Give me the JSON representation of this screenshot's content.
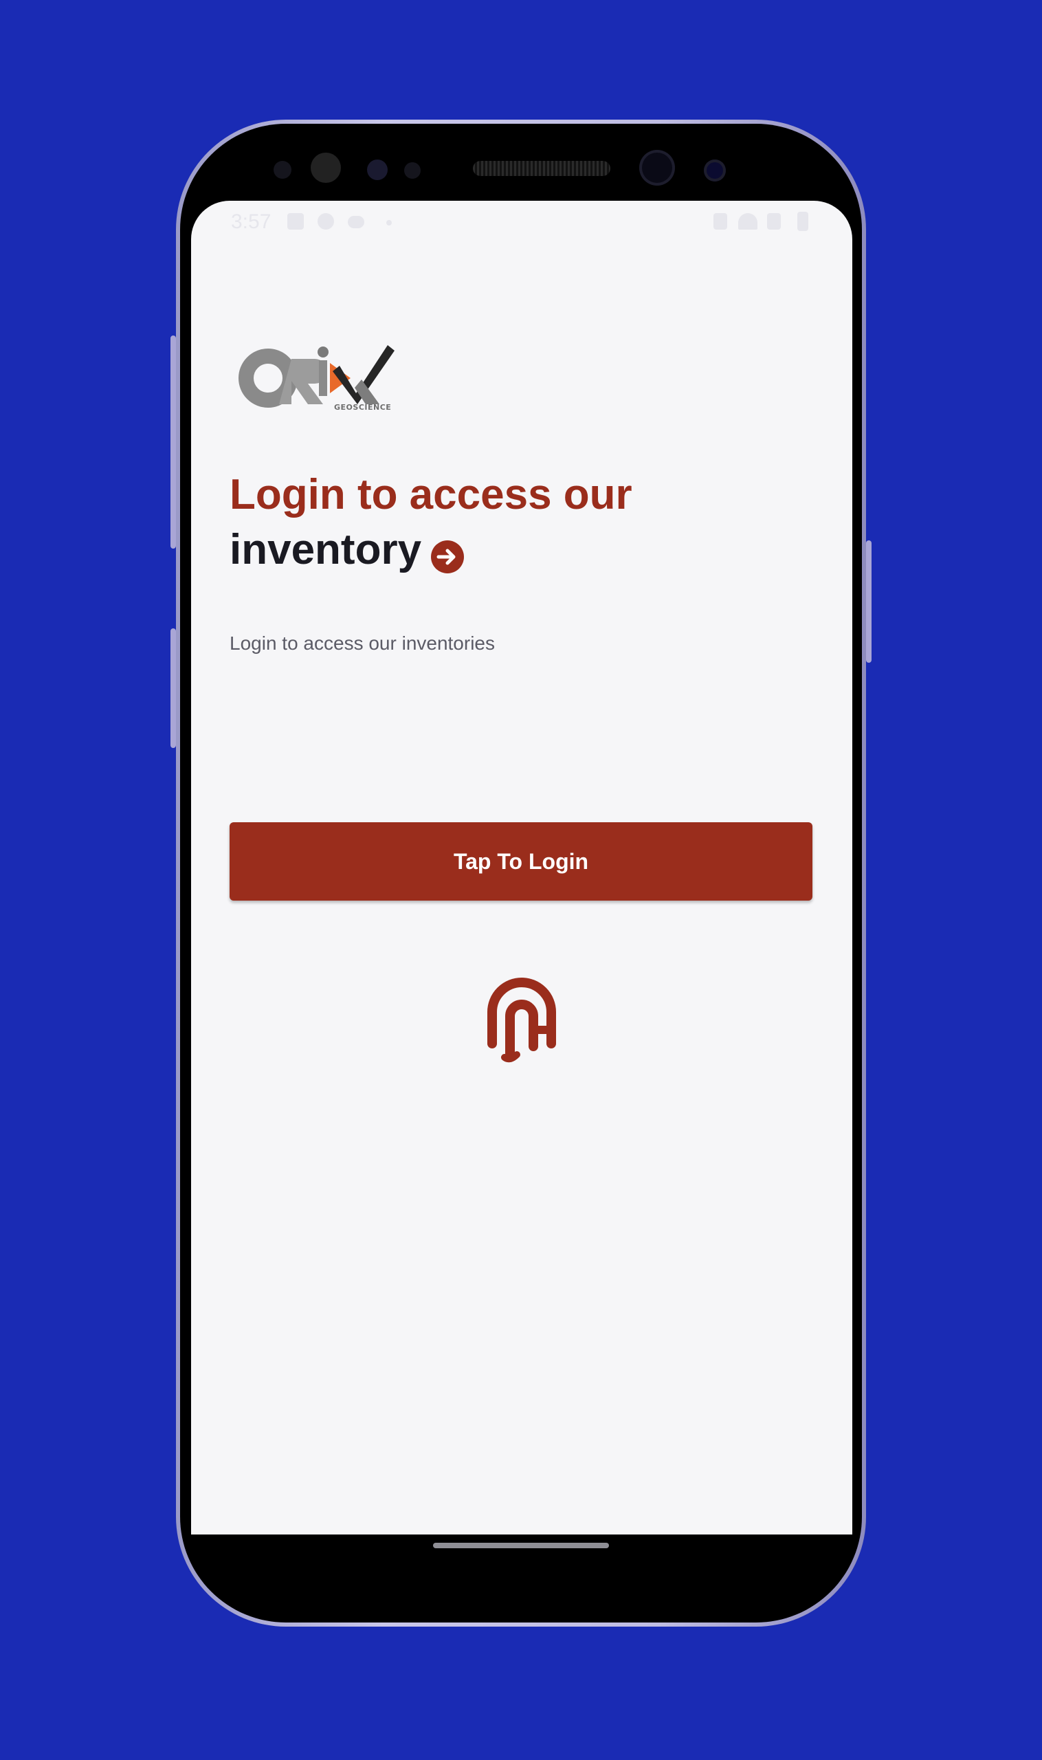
{
  "status_bar": {
    "time": "3:57",
    "icons": [
      "image-icon",
      "info-icon",
      "cloud-icon",
      "dot-icon",
      "signal-icon",
      "wifi-icon",
      "cellular-icon",
      "battery-icon"
    ]
  },
  "brand": {
    "logo_text": "ORIX",
    "logo_subtext": "GEOSCIENCE",
    "accent_color": "#9a2d1c",
    "background_color": "#1a2bb4"
  },
  "login": {
    "heading_line1": "Login to access our",
    "heading_line2": "inventory",
    "subtitle": "Login to access our inventories",
    "button_label": "Tap To Login"
  },
  "icons": {
    "heading_arrow": "arrow-right-circle-icon",
    "biometric": "fingerprint-icon"
  }
}
